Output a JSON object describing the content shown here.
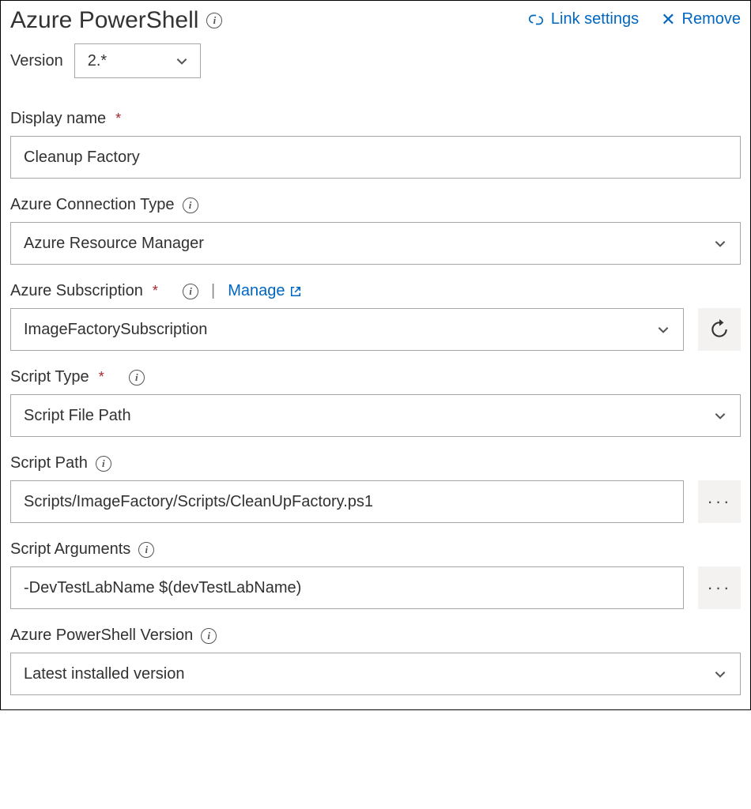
{
  "header": {
    "title": "Azure PowerShell",
    "link_settings": "Link settings",
    "remove": "Remove"
  },
  "version": {
    "label": "Version",
    "value": "2.*"
  },
  "fields": {
    "display_name": {
      "label": "Display name",
      "value": "Cleanup Factory"
    },
    "connection_type": {
      "label": "Azure Connection Type",
      "value": "Azure Resource Manager"
    },
    "subscription": {
      "label": "Azure Subscription",
      "manage": "Manage",
      "value": "ImageFactorySubscription"
    },
    "script_type": {
      "label": "Script Type",
      "value": "Script File Path"
    },
    "script_path": {
      "label": "Script Path",
      "value": "Scripts/ImageFactory/Scripts/CleanUpFactory.ps1"
    },
    "script_args": {
      "label": "Script Arguments",
      "value": "-DevTestLabName $(devTestLabName)"
    },
    "ps_version": {
      "label": "Azure PowerShell Version",
      "value": "Latest installed version"
    }
  }
}
